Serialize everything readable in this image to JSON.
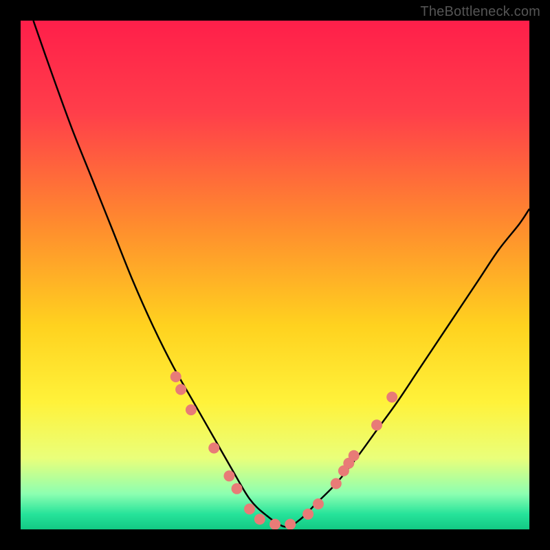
{
  "watermark": "TheBottleneck.com",
  "chart_data": {
    "type": "line",
    "title": "",
    "xlabel": "",
    "ylabel": "",
    "xlim": [
      0,
      100
    ],
    "ylim": [
      0,
      100
    ],
    "series": [
      {
        "name": "curve",
        "x": [
          2.5,
          6,
          10,
          14,
          18,
          22,
          26,
          30,
          34,
          38,
          42,
          45,
          48,
          52,
          55,
          58,
          62,
          66,
          70,
          74,
          78,
          82,
          86,
          90,
          94,
          98,
          100
        ],
        "y": [
          100,
          90,
          79,
          69,
          59,
          49,
          40,
          32,
          25,
          18,
          11,
          6,
          3,
          0.5,
          2,
          5,
          9,
          14,
          19.5,
          25,
          31,
          37,
          43,
          49,
          55,
          60,
          63
        ]
      }
    ],
    "markers": [
      {
        "x": 30.5,
        "y": 30
      },
      {
        "x": 31.5,
        "y": 27.5
      },
      {
        "x": 33.5,
        "y": 23.5
      },
      {
        "x": 38,
        "y": 16
      },
      {
        "x": 41,
        "y": 10.5
      },
      {
        "x": 42.5,
        "y": 8
      },
      {
        "x": 45,
        "y": 4
      },
      {
        "x": 47,
        "y": 2
      },
      {
        "x": 50,
        "y": 1
      },
      {
        "x": 53,
        "y": 1
      },
      {
        "x": 56.5,
        "y": 3
      },
      {
        "x": 58.5,
        "y": 5
      },
      {
        "x": 62,
        "y": 9
      },
      {
        "x": 63.5,
        "y": 11.5
      },
      {
        "x": 64.5,
        "y": 13
      },
      {
        "x": 65.5,
        "y": 14.5
      },
      {
        "x": 70,
        "y": 20.5
      },
      {
        "x": 73,
        "y": 26
      }
    ],
    "gradient_stops": [
      {
        "offset": 0.0,
        "color": "#ff1f4a"
      },
      {
        "offset": 0.18,
        "color": "#ff3e4a"
      },
      {
        "offset": 0.4,
        "color": "#ff8b2e"
      },
      {
        "offset": 0.6,
        "color": "#ffd21f"
      },
      {
        "offset": 0.75,
        "color": "#fff23a"
      },
      {
        "offset": 0.86,
        "color": "#eaff7a"
      },
      {
        "offset": 0.93,
        "color": "#8dffb1"
      },
      {
        "offset": 0.97,
        "color": "#26e39a"
      },
      {
        "offset": 1.0,
        "color": "#12c983"
      }
    ],
    "curve_color": "#000000",
    "marker_color": "#e87b77"
  }
}
